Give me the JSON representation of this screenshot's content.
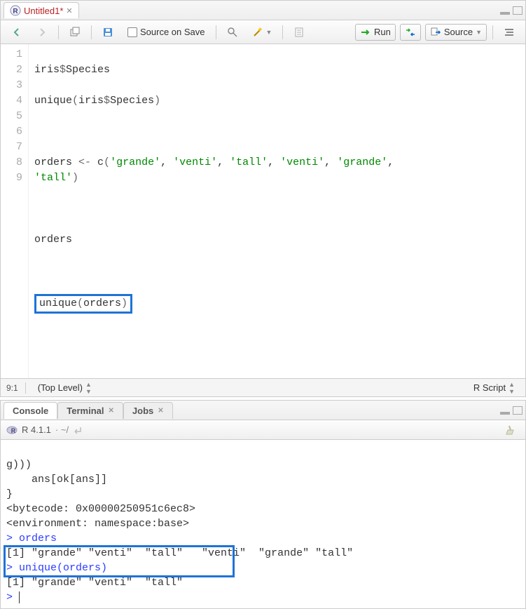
{
  "editor": {
    "tab_title": "Untitled1",
    "tab_dirty_marker": "*",
    "source_on_save_label": "Source on Save",
    "run_label": "Run",
    "source_label": "Source",
    "gutter": [
      "1",
      "2",
      "3",
      "4",
      "",
      "5",
      "6",
      "7",
      "8",
      "9"
    ],
    "code": {
      "l1": {
        "a": "iris",
        "b": "$",
        "c": "Species"
      },
      "l2": {
        "a": "unique",
        "b": "(",
        "c": "iris",
        "d": "$",
        "e": "Species",
        "f": ")"
      },
      "l4": {
        "a": "orders ",
        "b": "<-",
        "c": " c",
        "d": "(",
        "s1": "'grande'",
        "s2": "'venti'",
        "s3": "'tall'",
        "s4": "'venti'",
        "s5": "'grande'",
        "s6wrap": "'tall'",
        "e": ")"
      },
      "l6": "orders",
      "l8": {
        "a": "unique",
        "b": "(",
        "c": "orders",
        "d": ")"
      }
    },
    "cursor_pos": "9:1",
    "scope": "(Top Level)",
    "lang": "R Script"
  },
  "console": {
    "tabs": {
      "console": "Console",
      "terminal": "Terminal",
      "jobs": "Jobs"
    },
    "version": "R 4.1.1",
    "path": " · ~/",
    "lines": {
      "a": "g)))",
      "b": "    ans[ok[ans]]",
      "c": "}",
      "d": "<bytecode: 0x00000250951c6ec8>",
      "e": "<environment: namespace:base>",
      "f_prompt": "> ",
      "f_cmd": "orders",
      "g": "[1] \"grande\" \"venti\"  \"tall\"   \"venti\"  \"grande\" \"tall\"  ",
      "h_prompt": "> ",
      "h_cmd": "unique(orders)",
      "i": "[1] \"grande\" \"venti\"  \"tall\"  ",
      "j_prompt": "> "
    }
  }
}
